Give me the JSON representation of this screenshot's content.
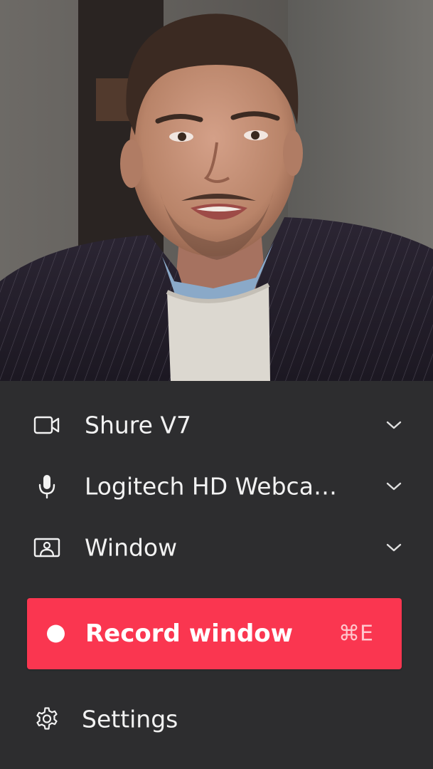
{
  "preview": {
    "description_icon": "webcam-preview"
  },
  "menu": {
    "camera": {
      "icon": "video-camera-icon",
      "label": "Shure V7"
    },
    "microphone": {
      "icon": "microphone-icon",
      "label": "Logitech HD Webcam..."
    },
    "capture_mode": {
      "icon": "window-portrait-icon",
      "label": "Window"
    }
  },
  "record": {
    "label": "Record window",
    "shortcut": "⌘E",
    "color": "#fa3650"
  },
  "settings": {
    "icon": "gear-icon",
    "label": "Settings"
  },
  "colors": {
    "panel_background": "#2d2d2f",
    "text": "#f2f2f2",
    "accent": "#fa3650"
  }
}
